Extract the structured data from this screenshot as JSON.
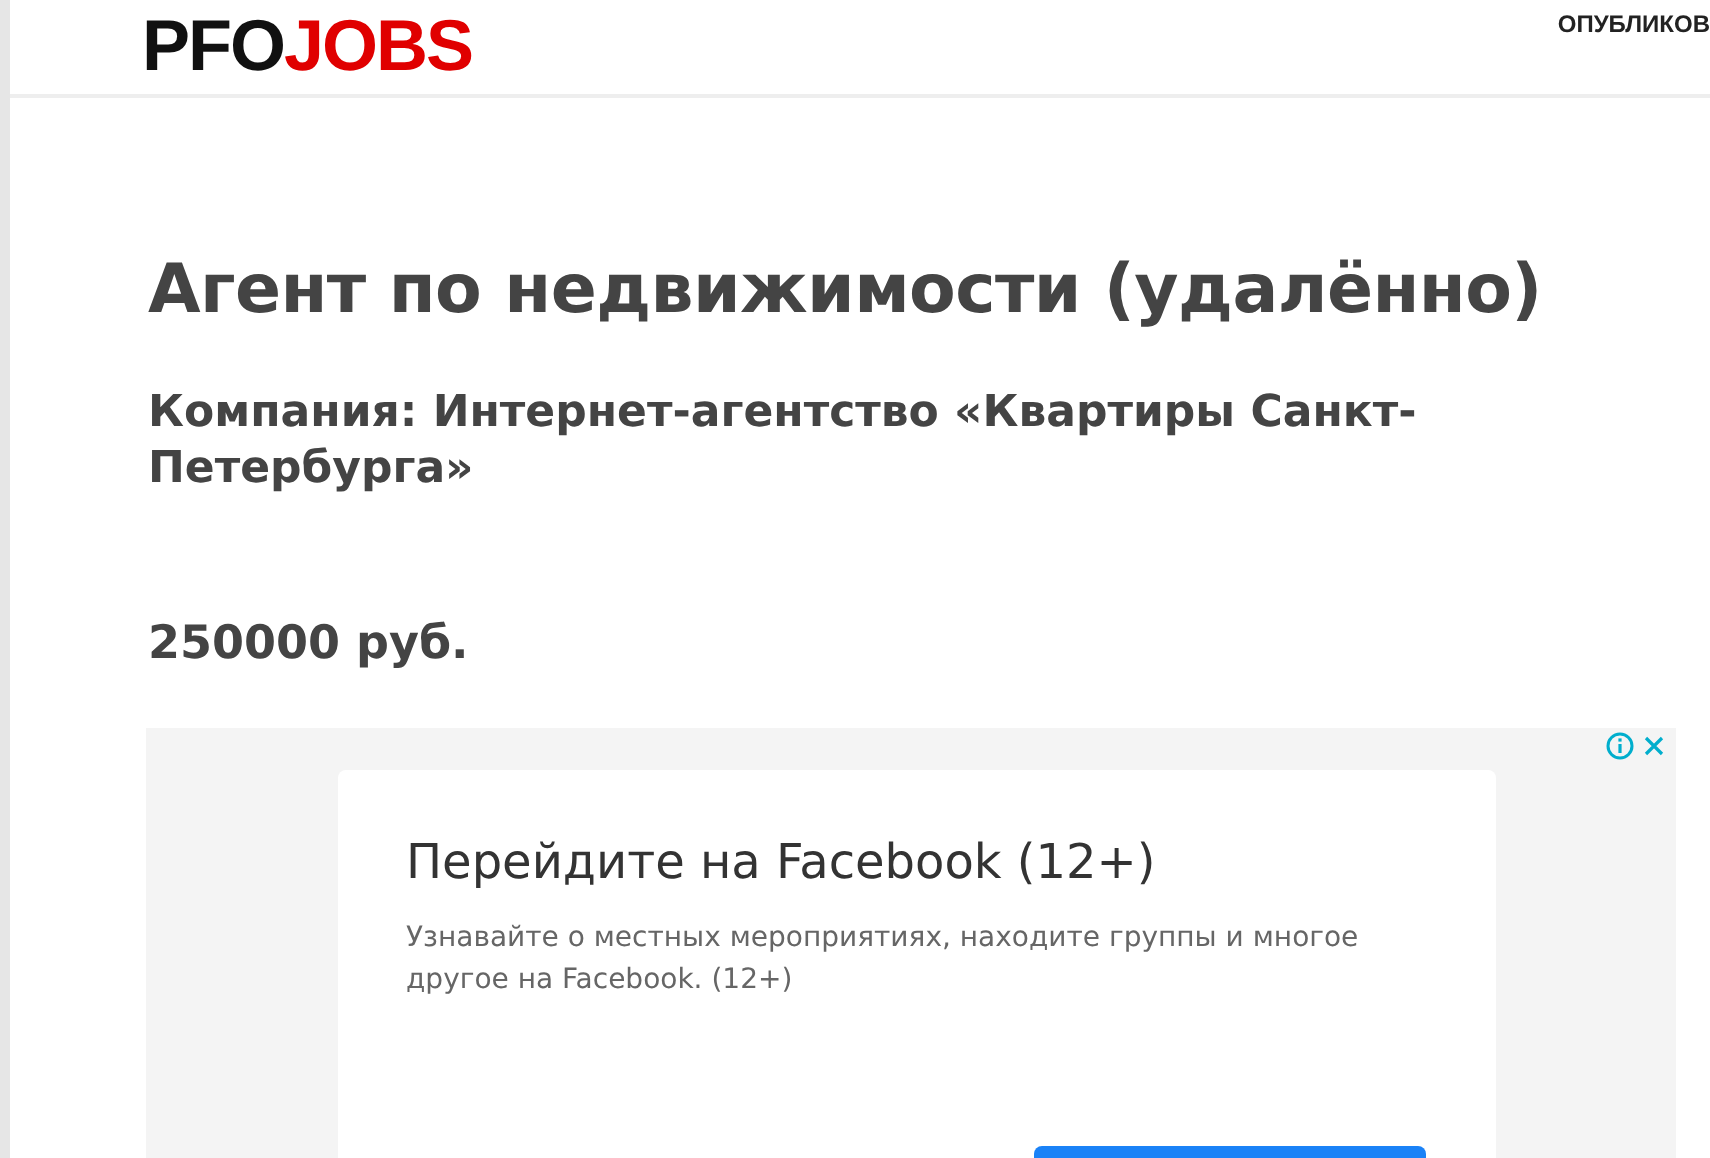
{
  "header": {
    "logo": [
      {
        "kind": "dark",
        "text": "PFO"
      },
      {
        "kind": "accent",
        "text": "JOBS"
      }
    ],
    "nav": [
      {
        "label": "ОПУБЛИКОВ"
      }
    ]
  },
  "job": {
    "title": "Агент по недвижимости (удалённо)",
    "company": "Компания: Интернет-агентство «Квартиры Санкт-Петербурга»",
    "salary": "250000 руб."
  },
  "ad": {
    "title": "Перейдите на Facebook (12+)",
    "text": "Узнавайте о местных мероприятиях, находите группы и многое другое на Facebook. (12+)"
  }
}
